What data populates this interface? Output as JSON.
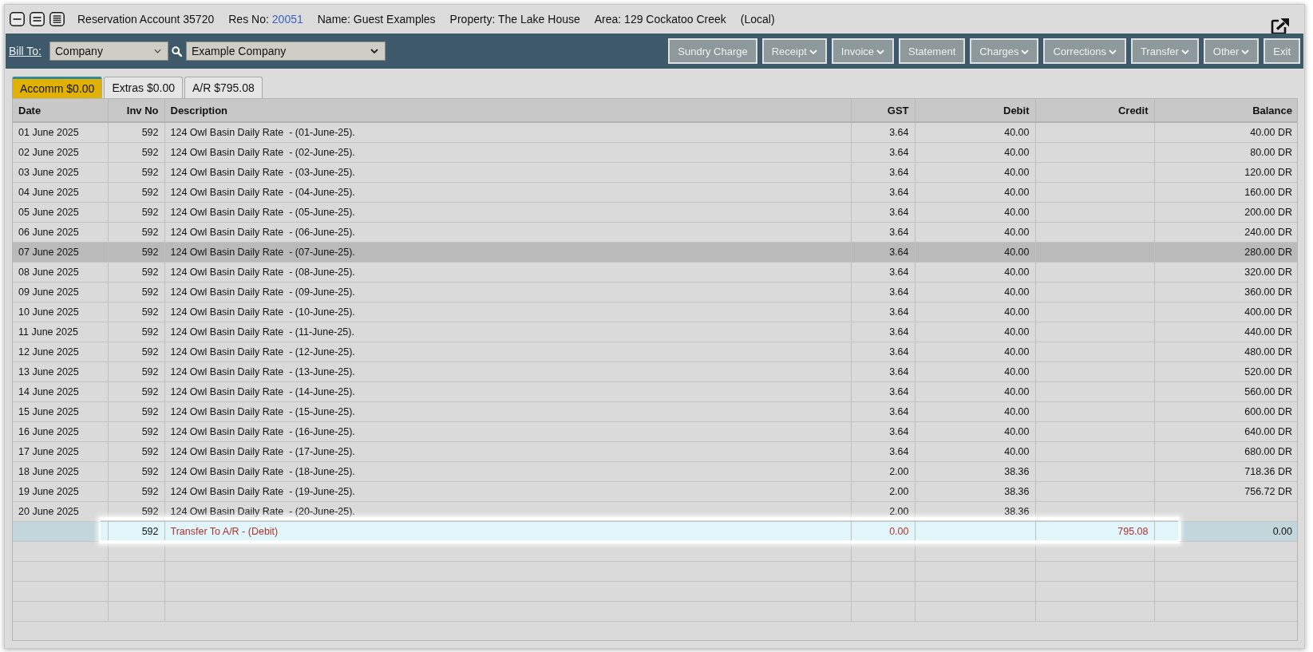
{
  "header": {
    "title": "Reservation Account 35720",
    "res_no_label": "Res No:",
    "res_no": "20051",
    "name": "Name: Guest Examples",
    "property": "Property: The Lake House",
    "area": "Area: 129 Cockatoo Creek",
    "location": "(Local)"
  },
  "toolbar": {
    "bill_to_label": "Bill To:",
    "bill_to_type": {
      "value": "Company"
    },
    "company": {
      "value": "Example Company"
    },
    "buttons": [
      {
        "label": "Sundry Charge",
        "dropdown": false
      },
      {
        "label": "Receipt",
        "dropdown": true
      },
      {
        "label": "Invoice",
        "dropdown": true
      },
      {
        "label": "Statement",
        "dropdown": false
      },
      {
        "label": "Charges",
        "dropdown": true
      },
      {
        "label": "Corrections",
        "dropdown": true
      },
      {
        "label": "Transfer",
        "dropdown": true
      },
      {
        "label": "Other",
        "dropdown": true
      },
      {
        "label": "Exit",
        "dropdown": false
      }
    ]
  },
  "tabs": [
    {
      "label": "Accomm $0.00",
      "selected": true
    },
    {
      "label": "Extras $0.00",
      "selected": false
    },
    {
      "label": "A/R $795.08",
      "selected": false
    }
  ],
  "table": {
    "columns": [
      {
        "label": "Date",
        "kind": "text"
      },
      {
        "label": "Inv No",
        "kind": "number"
      },
      {
        "label": "Description",
        "kind": "text"
      },
      {
        "label": "GST",
        "kind": "number"
      },
      {
        "label": "Debit",
        "kind": "number"
      },
      {
        "label": "Credit",
        "kind": "number"
      },
      {
        "label": "Balance",
        "kind": "number"
      }
    ],
    "rows": [
      {
        "kind": "charge",
        "selected": false,
        "hovered": false,
        "date": "01 June 2025",
        "inv_no": "592",
        "description": "124 Owl Basin Daily Rate  - (01-June-25).",
        "gst": "3.64",
        "debit": "40.00",
        "balance": "40.00 DR"
      },
      {
        "kind": "charge",
        "selected": false,
        "hovered": false,
        "date": "02 June 2025",
        "inv_no": "592",
        "description": "124 Owl Basin Daily Rate  - (02-June-25).",
        "gst": "3.64",
        "debit": "40.00",
        "balance": "80.00 DR"
      },
      {
        "kind": "charge",
        "selected": false,
        "hovered": false,
        "date": "03 June 2025",
        "inv_no": "592",
        "description": "124 Owl Basin Daily Rate  - (03-June-25).",
        "gst": "3.64",
        "debit": "40.00",
        "balance": "120.00 DR"
      },
      {
        "kind": "charge",
        "selected": false,
        "hovered": false,
        "date": "04 June 2025",
        "inv_no": "592",
        "description": "124 Owl Basin Daily Rate  - (04-June-25).",
        "gst": "3.64",
        "debit": "40.00",
        "balance": "160.00 DR"
      },
      {
        "kind": "charge",
        "selected": false,
        "hovered": false,
        "date": "05 June 2025",
        "inv_no": "592",
        "description": "124 Owl Basin Daily Rate  - (05-June-25).",
        "gst": "3.64",
        "debit": "40.00",
        "balance": "200.00 DR"
      },
      {
        "kind": "charge",
        "selected": false,
        "hovered": false,
        "date": "06 June 2025",
        "inv_no": "592",
        "description": "124 Owl Basin Daily Rate  - (06-June-25).",
        "gst": "3.64",
        "debit": "40.00",
        "balance": "240.00 DR"
      },
      {
        "kind": "charge",
        "selected": false,
        "hovered": true,
        "date": "07 June 2025",
        "inv_no": "592",
        "description": "124 Owl Basin Daily Rate  - (07-June-25).",
        "gst": "3.64",
        "debit": "40.00",
        "balance": "280.00 DR"
      },
      {
        "kind": "charge",
        "selected": false,
        "hovered": false,
        "date": "08 June 2025",
        "inv_no": "592",
        "description": "124 Owl Basin Daily Rate  - (08-June-25).",
        "gst": "3.64",
        "debit": "40.00",
        "balance": "320.00 DR"
      },
      {
        "kind": "charge",
        "selected": false,
        "hovered": false,
        "date": "09 June 2025",
        "inv_no": "592",
        "description": "124 Owl Basin Daily Rate  - (09-June-25).",
        "gst": "3.64",
        "debit": "40.00",
        "balance": "360.00 DR"
      },
      {
        "kind": "charge",
        "selected": false,
        "hovered": false,
        "date": "10 June 2025",
        "inv_no": "592",
        "description": "124 Owl Basin Daily Rate  - (10-June-25).",
        "gst": "3.64",
        "debit": "40.00",
        "balance": "400.00 DR"
      },
      {
        "kind": "charge",
        "selected": false,
        "hovered": false,
        "date": "11 June 2025",
        "inv_no": "592",
        "description": "124 Owl Basin Daily Rate  - (11-June-25).",
        "gst": "3.64",
        "debit": "40.00",
        "balance": "440.00 DR"
      },
      {
        "kind": "charge",
        "selected": false,
        "hovered": false,
        "date": "12 June 2025",
        "inv_no": "592",
        "description": "124 Owl Basin Daily Rate  - (12-June-25).",
        "gst": "3.64",
        "debit": "40.00",
        "balance": "480.00 DR"
      },
      {
        "kind": "charge",
        "selected": false,
        "hovered": false,
        "date": "13 June 2025",
        "inv_no": "592",
        "description": "124 Owl Basin Daily Rate  - (13-June-25).",
        "gst": "3.64",
        "debit": "40.00",
        "balance": "520.00 DR"
      },
      {
        "kind": "charge",
        "selected": false,
        "hovered": false,
        "date": "14 June 2025",
        "inv_no": "592",
        "description": "124 Owl Basin Daily Rate  - (14-June-25).",
        "gst": "3.64",
        "debit": "40.00",
        "balance": "560.00 DR"
      },
      {
        "kind": "charge",
        "selected": false,
        "hovered": false,
        "date": "15 June 2025",
        "inv_no": "592",
        "description": "124 Owl Basin Daily Rate  - (15-June-25).",
        "gst": "3.64",
        "debit": "40.00",
        "balance": "600.00 DR"
      },
      {
        "kind": "charge",
        "selected": false,
        "hovered": false,
        "date": "16 June 2025",
        "inv_no": "592",
        "description": "124 Owl Basin Daily Rate  - (16-June-25).",
        "gst": "3.64",
        "debit": "40.00",
        "balance": "640.00 DR"
      },
      {
        "kind": "charge",
        "selected": false,
        "hovered": false,
        "date": "17 June 2025",
        "inv_no": "592",
        "description": "124 Owl Basin Daily Rate  - (17-June-25).",
        "gst": "3.64",
        "debit": "40.00",
        "balance": "680.00 DR"
      },
      {
        "kind": "charge",
        "selected": false,
        "hovered": false,
        "date": "18 June 2025",
        "inv_no": "592",
        "description": "124 Owl Basin Daily Rate  - (18-June-25).",
        "gst": "2.00",
        "debit": "38.36",
        "balance": "718.36 DR"
      },
      {
        "kind": "charge",
        "selected": false,
        "hovered": false,
        "date": "19 June 2025",
        "inv_no": "592",
        "description": "124 Owl Basin Daily Rate  - (19-June-25).",
        "gst": "2.00",
        "debit": "38.36",
        "balance": "756.72 DR"
      },
      {
        "kind": "charge",
        "selected": false,
        "hovered": false,
        "date": "20 June 2025",
        "inv_no": "592",
        "description": "124 Owl Basin Daily Rate  - (20-June-25).",
        "gst": "2.00",
        "debit": "38.36"
      },
      {
        "kind": "transfer",
        "selected": true,
        "hovered": false,
        "inv_no": "592",
        "description": "Transfer To A/R - (Debit)",
        "gst": "0.00",
        "credit": "795.08",
        "balance": "0.00"
      }
    ]
  }
}
